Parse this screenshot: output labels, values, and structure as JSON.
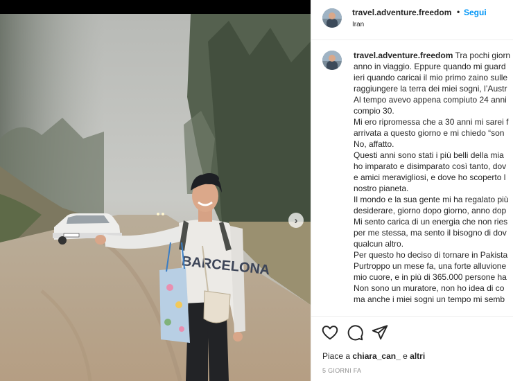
{
  "post": {
    "username": "travel.adventure.freedom",
    "separator": "•",
    "follow_label": "Segui",
    "location": "Iran",
    "caption_lines": [
      "Tra pochi giorn",
      "anno in viaggio. Eppure quando mi guard",
      "ieri quando caricai il mio primo zaino sulle",
      "raggiungere la terra dei miei sogni, l’Austr",
      "Al tempo avevo appena compiuto 24 anni",
      "compio 30.",
      "Mi ero ripromessa che a 30 anni mi sarei f",
      "arrivata a questo giorno e mi chiedo “son",
      "No, affatto.",
      "Questi anni sono stati i più belli della mia",
      "ho imparato e disimparato così tanto, dov",
      "e amici meravigliosi, e dove ho scoperto l",
      "nostro pianeta.",
      "Il mondo e la sua gente mi ha regalato più",
      "desiderare, giorno dopo giorno, anno dop",
      "Mi sento carica di un energia che non ries",
      "per me stessa, ma sento il bisogno di dov",
      "qualcun altro.",
      "Per questo ho deciso di tornare in Pakista",
      "Purtroppo un mese fa, una forte alluvione",
      "mio cuore, e in più di 365.000 persone ha",
      "Non sono un muratore, non ho idea di co",
      "ma anche i miei sogni un tempo mi semb"
    ],
    "photo_text": "BARCELONA",
    "likes_prefix": "Piace a",
    "likes_user": "chiara_can_",
    "likes_and": "e",
    "likes_others": "altri",
    "date": "5 GIORNI FA"
  },
  "icons": {
    "like": "heart-icon",
    "comment": "comment-bubble-icon",
    "share": "paper-plane-icon",
    "next": "chevron-right-icon"
  },
  "colors": {
    "follow": "#0095f6",
    "text": "#262626",
    "muted": "#8e8e8e"
  }
}
